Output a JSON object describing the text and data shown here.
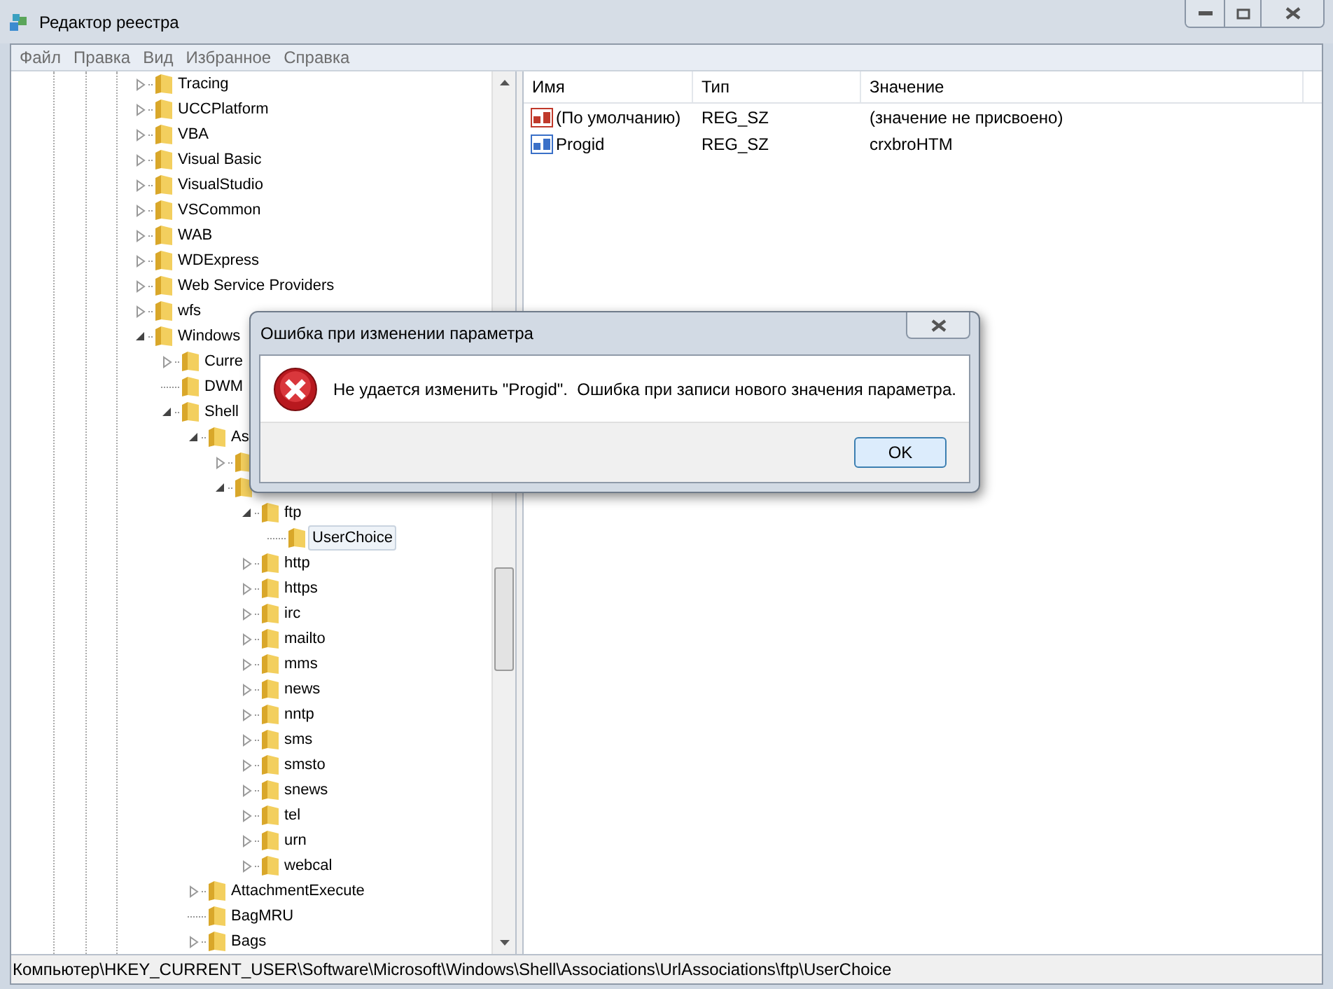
{
  "window": {
    "title": "Редактор реестра"
  },
  "menu": [
    "Файл",
    "Правка",
    "Вид",
    "Избранное",
    "Справка"
  ],
  "tree": [
    {
      "label": "Tracing",
      "kind": "branch",
      "expanded": false,
      "selected": false
    },
    {
      "label": "UCCPlatform",
      "kind": "branch",
      "expanded": false,
      "selected": false
    },
    {
      "label": "VBA",
      "kind": "branch",
      "expanded": false,
      "selected": false
    },
    {
      "label": "Visual Basic",
      "kind": "branch",
      "expanded": false,
      "selected": false
    },
    {
      "label": "VisualStudio",
      "kind": "branch",
      "expanded": false,
      "selected": false
    },
    {
      "label": "VSCommon",
      "kind": "branch",
      "expanded": false,
      "selected": false
    },
    {
      "label": "WAB",
      "kind": "branch",
      "expanded": false,
      "selected": false
    },
    {
      "label": "WDExpress",
      "kind": "branch",
      "expanded": false,
      "selected": false
    },
    {
      "label": "Web Service Providers",
      "kind": "branch",
      "expanded": false,
      "selected": false
    },
    {
      "label": "wfs",
      "kind": "branch",
      "expanded": false,
      "selected": false
    },
    {
      "label": "Windows",
      "kind": "branch",
      "expanded": true,
      "selected": false,
      "children": [
        {
          "label": "Curre",
          "kind": "branch",
          "expanded": false,
          "selected": false
        },
        {
          "label": "DWM",
          "kind": "leaf",
          "selected": false
        },
        {
          "label": "Shell",
          "kind": "branch",
          "expanded": true,
          "selected": false,
          "children": [
            {
              "label": "As",
              "kind": "branch",
              "expanded": true,
              "selected": false,
              "children": [
                {
                  "kind": "branch",
                  "expanded": false
                },
                {
                  "kind": "branch",
                  "expanded": true,
                  "children": [
                    {
                      "label": "ftp",
                      "kind": "branch",
                      "expanded": true,
                      "selected": false,
                      "children": [
                        {
                          "label": "UserChoice",
                          "kind": "leaf",
                          "selected": true
                        }
                      ]
                    },
                    {
                      "label": "http",
                      "kind": "branch",
                      "expanded": false,
                      "selected": false
                    },
                    {
                      "label": "https",
                      "kind": "branch",
                      "expanded": false,
                      "selected": false
                    },
                    {
                      "label": "irc",
                      "kind": "branch",
                      "expanded": false,
                      "selected": false
                    },
                    {
                      "label": "mailto",
                      "kind": "branch",
                      "expanded": false,
                      "selected": false
                    },
                    {
                      "label": "mms",
                      "kind": "branch",
                      "expanded": false,
                      "selected": false
                    },
                    {
                      "label": "news",
                      "kind": "branch",
                      "expanded": false,
                      "selected": false
                    },
                    {
                      "label": "nntp",
                      "kind": "branch",
                      "expanded": false,
                      "selected": false
                    },
                    {
                      "label": "sms",
                      "kind": "branch",
                      "expanded": false,
                      "selected": false
                    },
                    {
                      "label": "smsto",
                      "kind": "branch",
                      "expanded": false,
                      "selected": false
                    },
                    {
                      "label": "snews",
                      "kind": "branch",
                      "expanded": false,
                      "selected": false
                    },
                    {
                      "label": "tel",
                      "kind": "branch",
                      "expanded": false,
                      "selected": false
                    },
                    {
                      "label": "urn",
                      "kind": "branch",
                      "expanded": false,
                      "selected": false
                    },
                    {
                      "label": "webcal",
                      "kind": "branch",
                      "expanded": false,
                      "selected": false
                    }
                  ]
                }
              ]
            },
            {
              "label": "AttachmentExecute",
              "kind": "branch",
              "expanded": false,
              "selected": false
            },
            {
              "label": "BagMRU",
              "kind": "leaf",
              "selected": false
            },
            {
              "label": "Bags",
              "kind": "branch",
              "expanded": false,
              "selected": false
            }
          ]
        }
      ]
    }
  ],
  "table": {
    "columns": [
      "Имя",
      "Тип",
      "Значение"
    ],
    "rows": [
      {
        "name": "(По умолчанию)",
        "type": "REG_SZ",
        "value": "(значение не присвоено)",
        "color": "#c0392b"
      },
      {
        "name": "Progid",
        "type": "REG_SZ",
        "value": "crxbroHTM",
        "color": "#3a70c8"
      }
    ]
  },
  "status_bar": "Компьютер\\HKEY_CURRENT_USER\\Software\\Microsoft\\Windows\\Shell\\Associations\\UrlAssociations\\ftp\\UserChoice",
  "dialog": {
    "title": "Ошибка при изменении параметра",
    "message": "Не удается изменить \"Progid\".  Ошибка при записи нового значения параметра.",
    "buttons": [
      "OK"
    ]
  }
}
